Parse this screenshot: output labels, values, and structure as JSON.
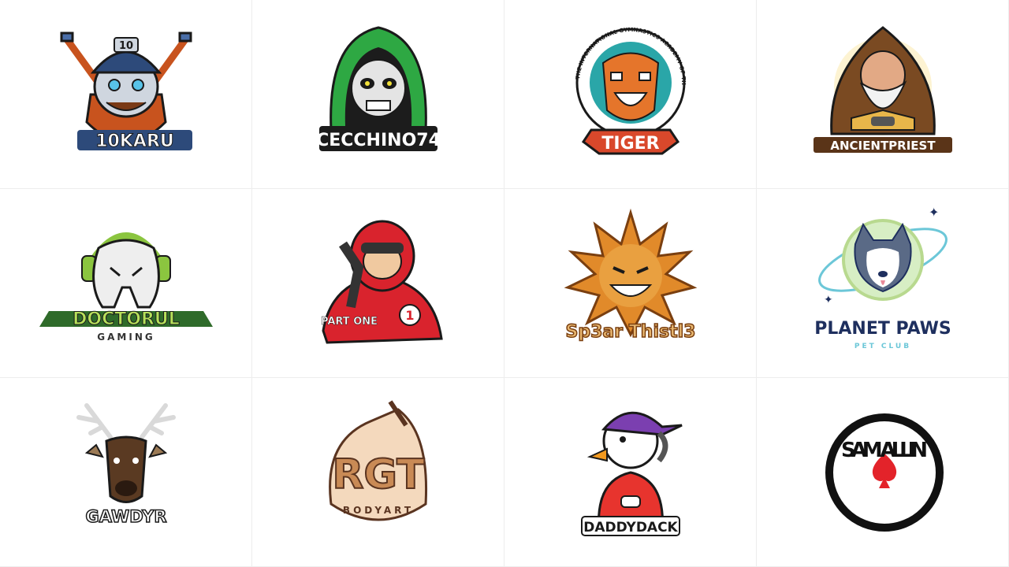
{
  "logos": [
    {
      "name": "10karu",
      "text": "10KARU",
      "helmet_number": "10",
      "colors": {
        "main": "#2d4a7a",
        "accent": "#c8531e"
      }
    },
    {
      "name": "cecchino74",
      "text": "CECCHINO74",
      "colors": {
        "main": "#2ea843",
        "accent": "#1c1c1c"
      }
    },
    {
      "name": "tiger",
      "text": "TIGER",
      "ring_text": "THE INTERNATIONAL GYMNASTICS ACADEMY OF THE ROCKIES",
      "colors": {
        "main": "#d9482b",
        "accent": "#2aa6a8"
      }
    },
    {
      "name": "ancientpriest",
      "text": "ANCIENTPRIEST",
      "colors": {
        "main": "#7a4a22",
        "accent": "#e8b64a"
      }
    },
    {
      "name": "doctorul",
      "text": "DOCTORUL",
      "subtext": "GAMING",
      "colors": {
        "main": "#8bc53f",
        "accent": "#2f6b2a"
      }
    },
    {
      "name": "partone",
      "text": "PART ONE",
      "badge": "1",
      "colors": {
        "main": "#d9232d",
        "accent": "#222222"
      }
    },
    {
      "name": "sp3ar-thistl3",
      "text": "Sp3ar Thistl3",
      "colors": {
        "main": "#e18a2a",
        "accent": "#7a3f10"
      }
    },
    {
      "name": "planet-paws",
      "text": "PLANET PAWS",
      "subtext": "PET CLUB",
      "colors": {
        "main": "#1e2f5e",
        "accent": "#6cc7d8"
      }
    },
    {
      "name": "gawdyr",
      "text": "GAWDYR",
      "colors": {
        "main": "#5a3a22",
        "accent": "#9b7a55"
      }
    },
    {
      "name": "rgt-bodyart",
      "text": "RGT",
      "subtext": "BODYART",
      "colors": {
        "main": "#c98a55",
        "accent": "#5a3420"
      }
    },
    {
      "name": "daddydack",
      "text": "DADDYDACK",
      "colors": {
        "main": "#e7342e",
        "accent": "#f39a1f"
      }
    },
    {
      "name": "sam-allin",
      "text": "SAM ALLIN",
      "colors": {
        "main": "#111111",
        "accent": "#e3232a"
      }
    }
  ]
}
